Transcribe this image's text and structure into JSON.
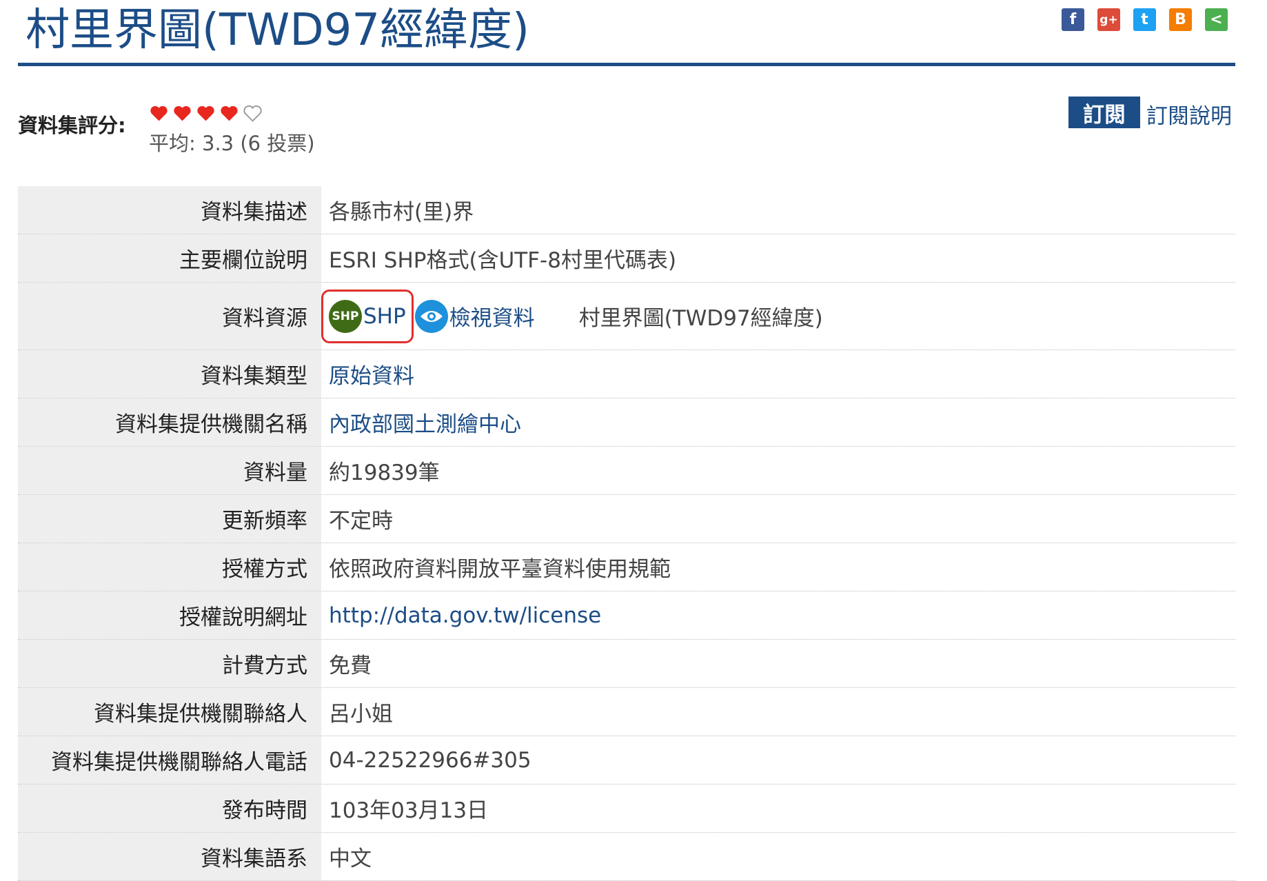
{
  "page": {
    "title": "村里界圖(TWD97經緯度)"
  },
  "share": [
    {
      "name": "facebook-icon",
      "glyph": "f",
      "color": "#3b5998"
    },
    {
      "name": "google-plus-icon",
      "glyph": "g+",
      "color": "#dd4b39"
    },
    {
      "name": "twitter-icon",
      "glyph": "t",
      "color": "#1da1f2"
    },
    {
      "name": "blogger-icon",
      "glyph": "B",
      "color": "#f57d00"
    },
    {
      "name": "share-icon",
      "glyph": "<",
      "color": "#4caf50"
    }
  ],
  "rating": {
    "label": "資料集評分:",
    "stars_filled": 4,
    "stars_total": 5,
    "average_text": "平均: 3.3 (6 投票)"
  },
  "subscribe": {
    "button_label": "訂閱",
    "help_label": "訂閱說明"
  },
  "details": {
    "description": {
      "key": "資料集描述",
      "value": "各縣市村(里)界"
    },
    "fields": {
      "key": "主要欄位說明",
      "value": "ESRI SHP格式(含UTF-8村里代碼表)"
    },
    "resource": {
      "key": "資料資源",
      "format_icon": "SHP",
      "format_label": "SHP",
      "view_label": "檢視資料",
      "name": "村里界圖(TWD97經緯度)"
    },
    "type": {
      "key": "資料集類型",
      "value": "原始資料"
    },
    "provider": {
      "key": "資料集提供機關名稱",
      "value": "內政部國土測繪中心"
    },
    "count": {
      "key": "資料量",
      "value": "約19839筆"
    },
    "frequency": {
      "key": "更新頻率",
      "value": "不定時"
    },
    "license": {
      "key": "授權方式",
      "value": "依照政府資料開放平臺資料使用規範"
    },
    "license_url": {
      "key": "授權說明網址",
      "value": "http://data.gov.tw/license"
    },
    "fee": {
      "key": "計費方式",
      "value": "免費"
    },
    "contact": {
      "key": "資料集提供機關聯絡人",
      "value": "呂小姐"
    },
    "phone": {
      "key": "資料集提供機關聯絡人電話",
      "value": "04-22522966#305"
    },
    "published": {
      "key": "發布時間",
      "value": "103年03月13日"
    },
    "language": {
      "key": "資料集語系",
      "value": "中文"
    }
  },
  "colors": {
    "accent": "#1c4d86",
    "heart": "#e8271f",
    "highlight": "#e0302d"
  }
}
